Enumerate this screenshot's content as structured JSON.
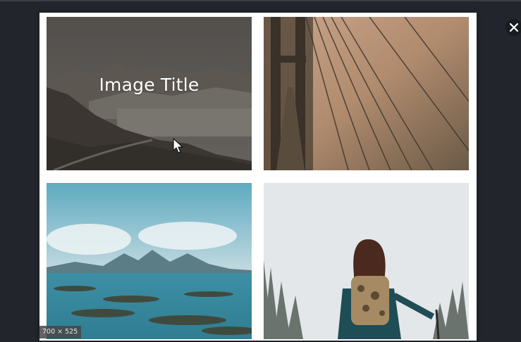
{
  "gallery": {
    "items": [
      {
        "title": "Image Title",
        "alt": "mountain-road-landscape",
        "hovered": true
      },
      {
        "title": "",
        "alt": "bridge-cables-sunset",
        "hovered": false
      },
      {
        "title": "",
        "alt": "coastal-lake-mountains",
        "hovered": false
      },
      {
        "title": "",
        "alt": "hiker-with-backpack-forest",
        "hovered": false
      }
    ]
  },
  "image_size_label": "700 × 525",
  "close_icon": "close-icon",
  "colors": {
    "backdrop": "#23252d",
    "frame": "#ffffff",
    "title_text": "#ffffff"
  }
}
